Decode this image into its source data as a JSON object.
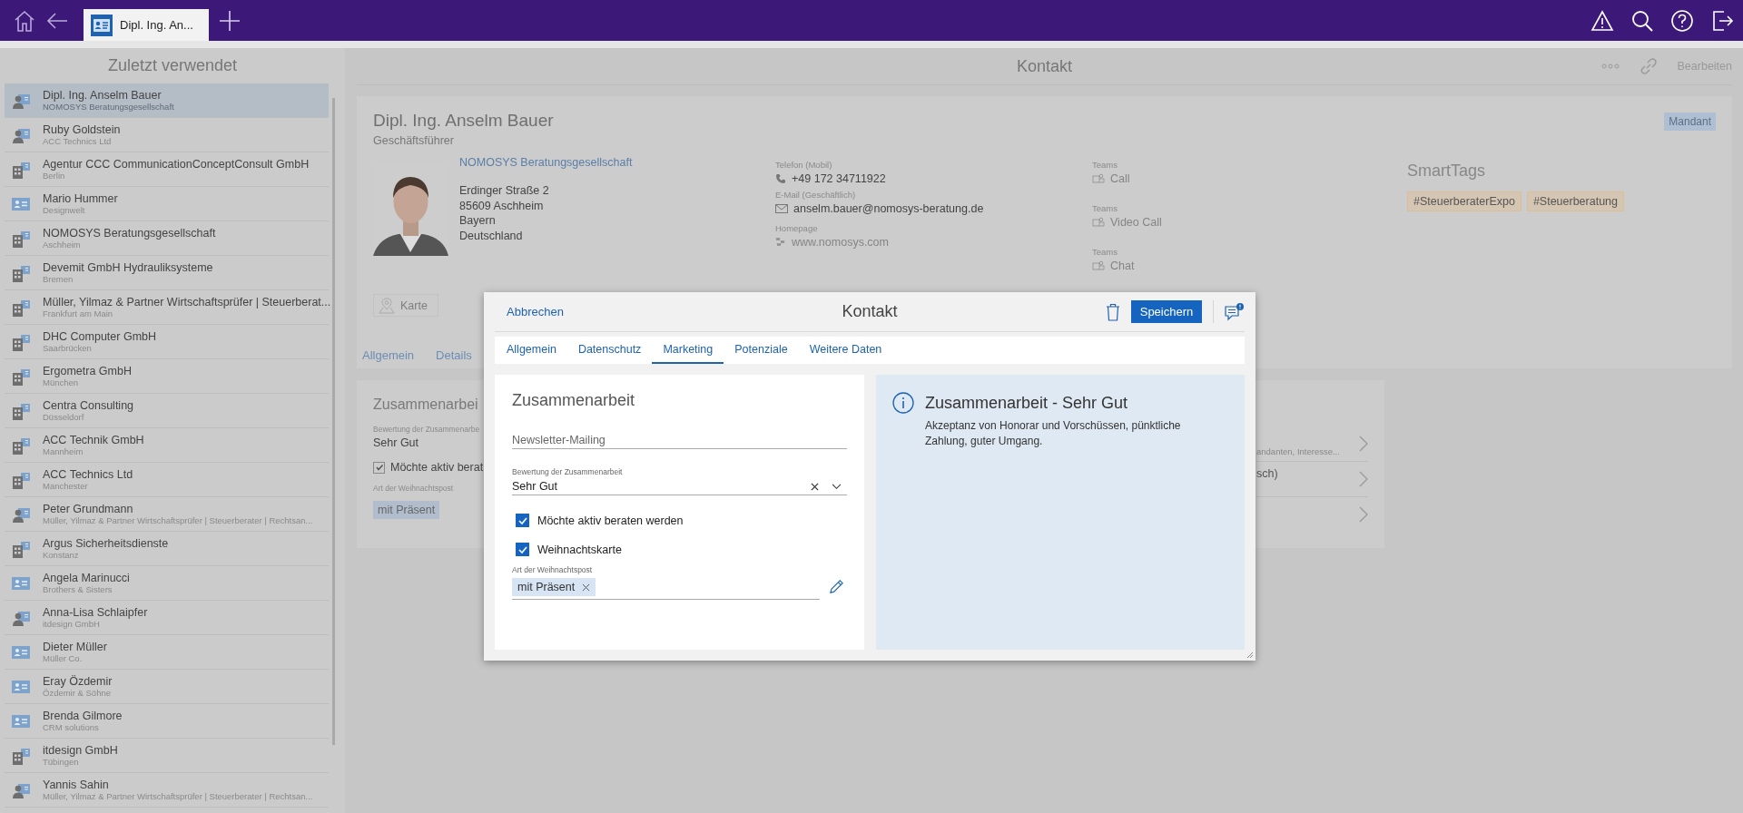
{
  "top_bar": {
    "tab": {
      "title": "Dipl. Ing. An...",
      "selected": true
    }
  },
  "sidebar": {
    "title": "Zuletzt verwendet",
    "items": [
      {
        "name": "Dipl. Ing. Anselm Bauer",
        "sub": "NOMOSYS Beratungsgesellschaft",
        "kind": "person",
        "selected": true
      },
      {
        "name": "Ruby Goldstein",
        "sub": "ACC Technics Ltd",
        "kind": "person",
        "selected": false
      },
      {
        "name": "Agentur CCC CommunicationConceptConsult GmbH",
        "sub": "Berlin",
        "kind": "company",
        "selected": false
      },
      {
        "name": "Mario Hummer",
        "sub": "Designwelt",
        "kind": "card",
        "selected": false
      },
      {
        "name": "NOMOSYS Beratungsgesellschaft",
        "sub": "Aschheim",
        "kind": "company",
        "selected": false
      },
      {
        "name": "Devemit GmbH Hydrauliksysteme",
        "sub": "Bremen",
        "kind": "company",
        "selected": false
      },
      {
        "name": "Müller, Yilmaz & Partner Wirtschaftsprüfer | Steuerberat...",
        "sub": "Frankfurt am Main",
        "kind": "company",
        "selected": false
      },
      {
        "name": "DHC Computer GmbH",
        "sub": "Saarbrücken",
        "kind": "company",
        "selected": false
      },
      {
        "name": "Ergometra GmbH",
        "sub": "München",
        "kind": "company",
        "selected": false
      },
      {
        "name": "Centra Consulting",
        "sub": "Düsseldorf",
        "kind": "company",
        "selected": false
      },
      {
        "name": "ACC Technik GmbH",
        "sub": "Mannheim",
        "kind": "company",
        "selected": false
      },
      {
        "name": "ACC Technics Ltd",
        "sub": "Manchester",
        "kind": "company",
        "selected": false
      },
      {
        "name": "Peter Grundmann",
        "sub": "Müller, Yilmaz & Partner Wirtschaftsprüfer | Steuerberater | Rechtsan...",
        "kind": "person",
        "selected": false
      },
      {
        "name": "Argus Sicherheitsdienste",
        "sub": "Konstanz",
        "kind": "company",
        "selected": false
      },
      {
        "name": "Angela Marinucci",
        "sub": "Brothers & Sisters",
        "kind": "card",
        "selected": false
      },
      {
        "name": "Anna-Lisa Schlaipfer",
        "sub": "itdesign GmbH",
        "kind": "person",
        "selected": false
      },
      {
        "name": "Dieter Müller",
        "sub": "Müller Co.",
        "kind": "card",
        "selected": false
      },
      {
        "name": "Eray Özdemir",
        "sub": "Özdemir & Söhne",
        "kind": "card",
        "selected": false
      },
      {
        "name": "Brenda Gilmore",
        "sub": "CRM solutions",
        "kind": "card",
        "selected": false
      },
      {
        "name": "itdesign GmbH",
        "sub": "Tübingen",
        "kind": "company",
        "selected": false
      },
      {
        "name": "Yannis Sahin",
        "sub": "Müller, Yilmaz & Partner Wirtschaftsprüfer | Steuerberater | Rechtsan...",
        "kind": "person",
        "selected": false
      }
    ]
  },
  "header": {
    "title": "Kontakt",
    "edit": "Bearbeiten"
  },
  "contact": {
    "name": "Dipl. Ing. Anselm Bauer",
    "role": "Geschäftsführer",
    "badge": "Mandant",
    "company": "NOMOSYS Beratungsgesellschaft",
    "address": [
      "Erdinger Straße 2",
      "85609 Aschheim",
      "Bayern",
      "Deutschland"
    ],
    "fields": [
      {
        "label": "Telefon (Mobil)",
        "value": "+49 172 34711922",
        "kind": "phone"
      },
      {
        "label": "E-Mail (Geschäftlich)",
        "value": "anselm.bauer@nomosys-beratung.de",
        "kind": "mail"
      },
      {
        "label": "Homepage",
        "value": "www.nomosys.com",
        "kind": "web"
      }
    ],
    "teams": [
      {
        "label": "Teams",
        "value": "Call"
      },
      {
        "label": "Teams",
        "value": "Video Call"
      },
      {
        "label": "Teams",
        "value": "Chat"
      }
    ],
    "smarttags": {
      "title": "SmartTags",
      "tags": [
        "#SteuerberaterExpo",
        "#Steuerberatung"
      ]
    },
    "map_button": "Karte",
    "tabs": [
      "Allgemein",
      "Details"
    ]
  },
  "section": {
    "title": "Zusammenarbei",
    "rating_label": "Bewertung der Zusammenarbe",
    "rating_value": "Sehr Gut",
    "checkbox": {
      "label": "Möchte aktiv berat",
      "checked": true
    },
    "post_label": "Art der Weihnachtspost",
    "post_value": "mit Präsent",
    "rows": [
      {
        "kind": "subtitle",
        "text": "andanten, Interesse..."
      },
      {
        "kind": "title",
        "text": "sch)"
      },
      {
        "kind": "blank"
      }
    ]
  },
  "dialog": {
    "cancel": "Abbrechen",
    "title": "Kontakt",
    "save": "Speichern",
    "tabs": [
      {
        "label": "Allgemein",
        "selected": false
      },
      {
        "label": "Datenschutz",
        "selected": false
      },
      {
        "label": "Marketing",
        "selected": true
      },
      {
        "label": "Potenziale",
        "selected": false
      },
      {
        "label": "Weitere Daten",
        "selected": false
      }
    ],
    "section_title": "Zusammenarbeit",
    "newsletter": {
      "placeholder": "Newsletter-Mailing"
    },
    "rating": {
      "label": "Bewertung der Zusammenarbeit",
      "value": "Sehr Gut"
    },
    "checkboxes": [
      {
        "label": "Möchte aktiv beraten werden",
        "checked": true
      },
      {
        "label": "Weihnachtskarte",
        "checked": true
      }
    ],
    "post": {
      "label": "Art der Weihnachtspost",
      "chips": [
        "mit Präsent"
      ]
    },
    "info": {
      "title": "Zusammenarbeit - Sehr Gut",
      "text": "Akzeptanz von Honorar und Vorschüssen, pünktliche Zahlung, guter Umgang."
    }
  }
}
